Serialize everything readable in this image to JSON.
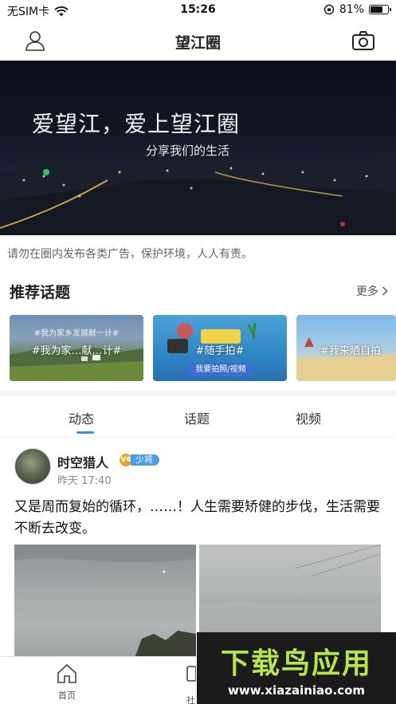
{
  "status_bar": {
    "carrier": "无SIM卡",
    "time": "15:26",
    "battery_percent": "81%",
    "battery_level": 0.81
  },
  "nav": {
    "title": "望江圈"
  },
  "banner": {
    "headline": "爱望江，爱上望江圈",
    "subline": "分享我们的生活"
  },
  "notice": "请勿在圈内发布各类广告，保护环境，人人有责。",
  "topics": {
    "title": "推荐话题",
    "more_label": "更多",
    "cards": [
      {
        "sub": "#我为家乡发展献一计#",
        "label": "#我为家…献…计#"
      },
      {
        "label": "#随手拍#",
        "button": "我要拍照/视频"
      },
      {
        "label": "#我来晒自拍"
      }
    ]
  },
  "tabs": [
    "动态",
    "话题",
    "视频"
  ],
  "post": {
    "author": "时空猎人",
    "level_icon": "V6",
    "rank": "少将",
    "time": "昨天 17:40",
    "text": "又是周而复始的循环，……！人生需要矫健的步伐，生活需要不断去改变。"
  },
  "bottom_nav": {
    "home_label": "首页",
    "social_label": "社"
  },
  "watermark": {
    "title": "下载鸟应用",
    "url": "www.xiazainiao.com"
  },
  "colors": {
    "accent": "#3a8ee6",
    "badge_gold": "#e0a822",
    "watermark_green": "#b9e44c"
  }
}
